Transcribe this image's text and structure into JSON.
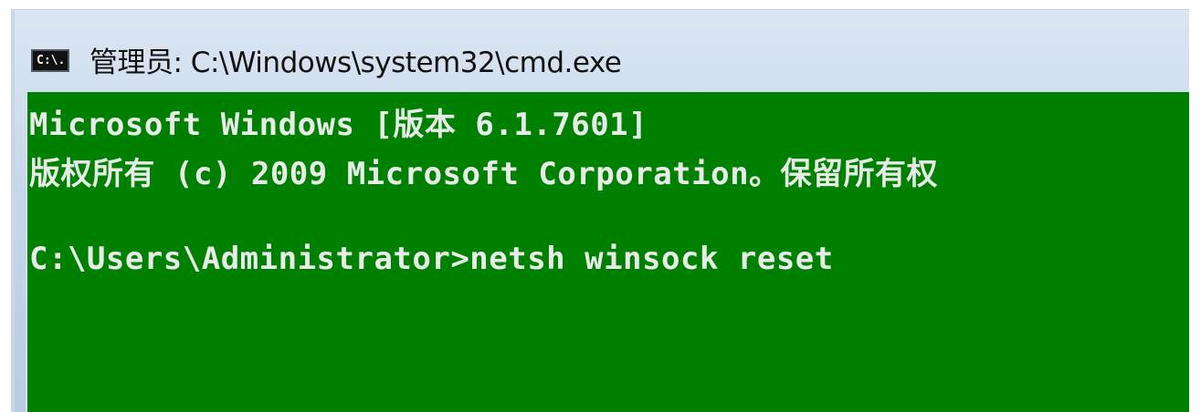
{
  "window": {
    "title": "管理员: C:\\Windows\\system32\\cmd.exe",
    "icon": "cmd-icon",
    "icon_glyph": "C:\\."
  },
  "console": {
    "background": "#008000",
    "text_color": "#e8ece8",
    "lines": [
      "Microsoft Windows [版本 6.1.7601]",
      "版权所有 (c) 2009 Microsoft Corporation。保留所有权",
      "",
      "C:\\Users\\Administrator>netsh winsock reset"
    ]
  }
}
